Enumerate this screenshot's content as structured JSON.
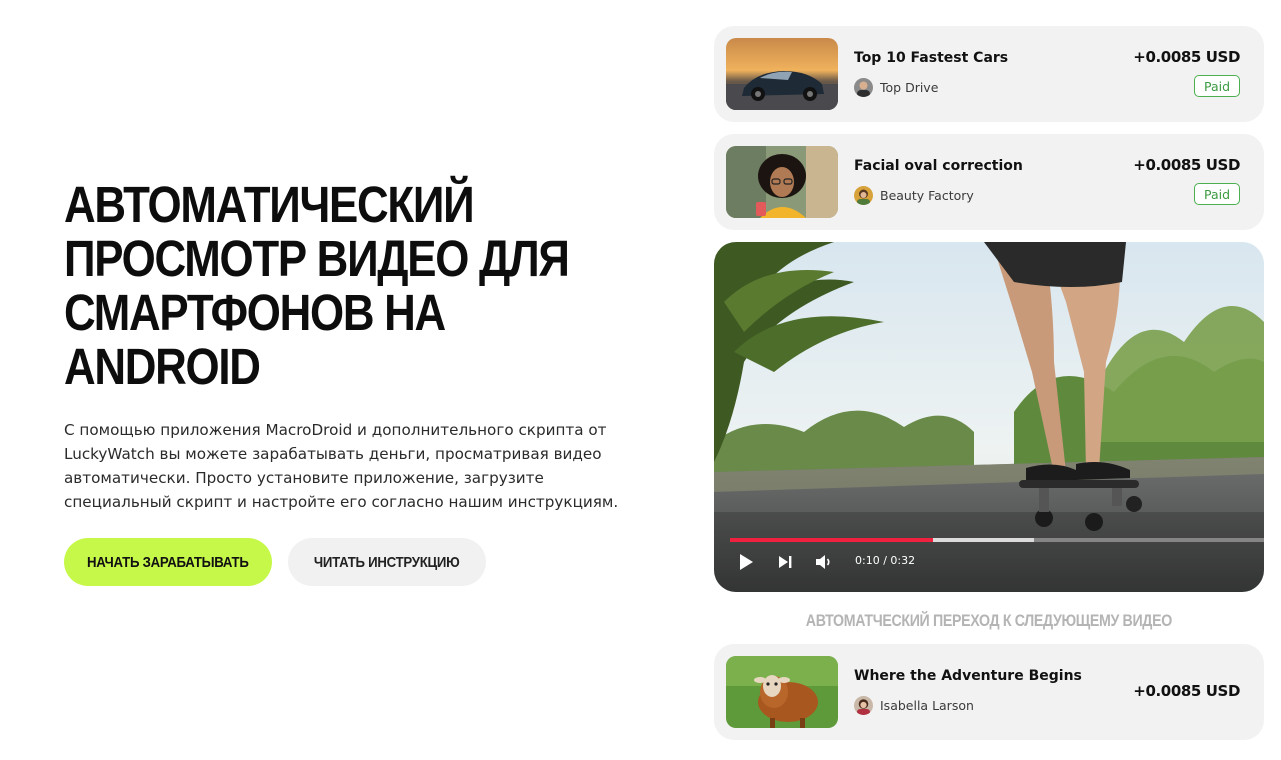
{
  "hero": {
    "title": "АВТОМАТИЧЕСКИЙ ПРОСМОТР ВИДЕО ДЛЯ СМАРТФОНОВ НА ANDROID",
    "description": "С помощью приложения MacroDroid и дополнительного скрипта от LuckyWatch вы можете зарабатывать деньги, просматривая видео автоматически. Просто установите приложение, загрузите специальный скрипт и настройте его согласно нашим инструкциям.",
    "primary_button": "НАЧАТЬ ЗАРАБАТЫВАТЬ",
    "secondary_button": "ЧИТАТЬ ИНСТРУКЦИЮ"
  },
  "videos": [
    {
      "title": "Top 10 Fastest Cars",
      "author": "Top Drive",
      "reward": "+0.0085 USD",
      "status": "Paid",
      "thumb_icon": "sports-car-thumbnail"
    },
    {
      "title": "Facial oval correction",
      "author": "Beauty Factory",
      "reward": "+0.0085 USD",
      "status": "Paid",
      "thumb_icon": "woman-portrait-thumbnail"
    },
    {
      "title": "Where the Adventure Begins",
      "author": "Isabella Larson",
      "reward": "+0.0085 USD",
      "thumb_icon": "sheep-thumbnail"
    }
  ],
  "player": {
    "time": "0:10 / 0:32",
    "progress_fraction": 0.38,
    "buffer_fraction": 0.57,
    "accent": "#f0213f",
    "icons": [
      "play-icon",
      "next-icon",
      "volume-icon"
    ]
  },
  "auto_next_label": "АВТОМАТЧЕСКИЙ ПЕРЕХОД К СЛЕДУЮЩЕМУ ВИДЕО",
  "colors": {
    "primary_button": "#c6f84a",
    "paid": "#3d9a41",
    "card": "#f2f2f2"
  }
}
